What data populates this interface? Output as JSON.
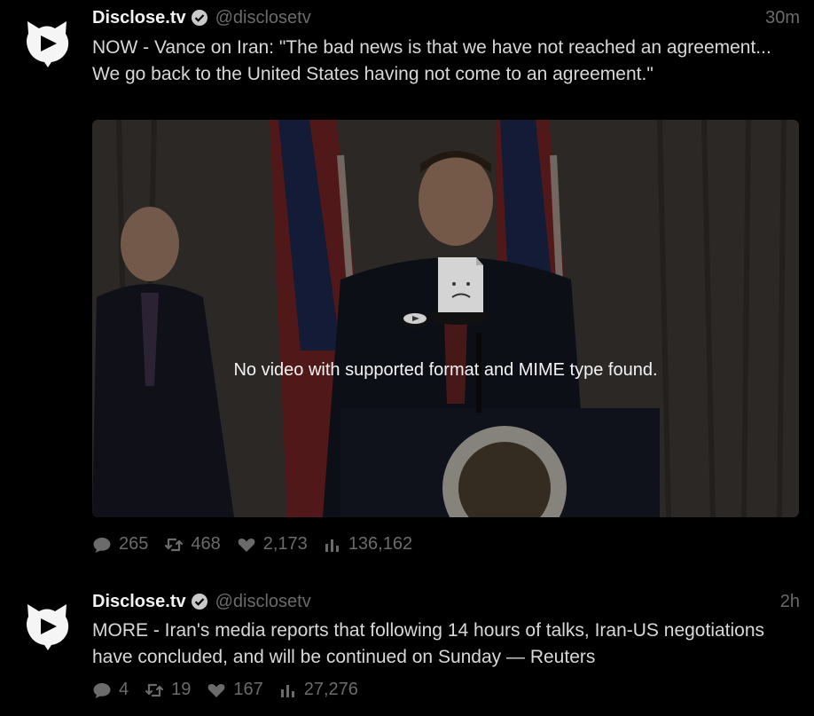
{
  "tweets": [
    {
      "author": "Disclose.tv",
      "handle": "@disclosetv",
      "time": "30m",
      "text": "NOW - Vance on Iran: \"The bad news is that we have not reached an agreement... We go back to the United States having not come to an agreement.\"",
      "media": {
        "error_text": "No video with supported format and MIME type found."
      },
      "stats": {
        "replies": "265",
        "retweets": "468",
        "likes": "2,173",
        "views": "136,162"
      }
    },
    {
      "author": "Disclose.tv",
      "handle": "@disclosetv",
      "time": "2h",
      "text": "MORE - Iran's media reports that following 14 hours of talks, Iran-US negotiations have concluded, and will be continued on Sunday — Reuters",
      "stats": {
        "replies": "4",
        "retweets": "19",
        "likes": "167",
        "views": "27,276"
      }
    }
  ],
  "icons": {
    "reply": "reply-icon",
    "retweet": "retweet-icon",
    "like": "heart-icon",
    "views": "views-icon",
    "verified": "verified-badge-icon"
  },
  "colors": {
    "background": "#000000",
    "muted": "#6b6b6b",
    "text": "#d8d8d8"
  }
}
